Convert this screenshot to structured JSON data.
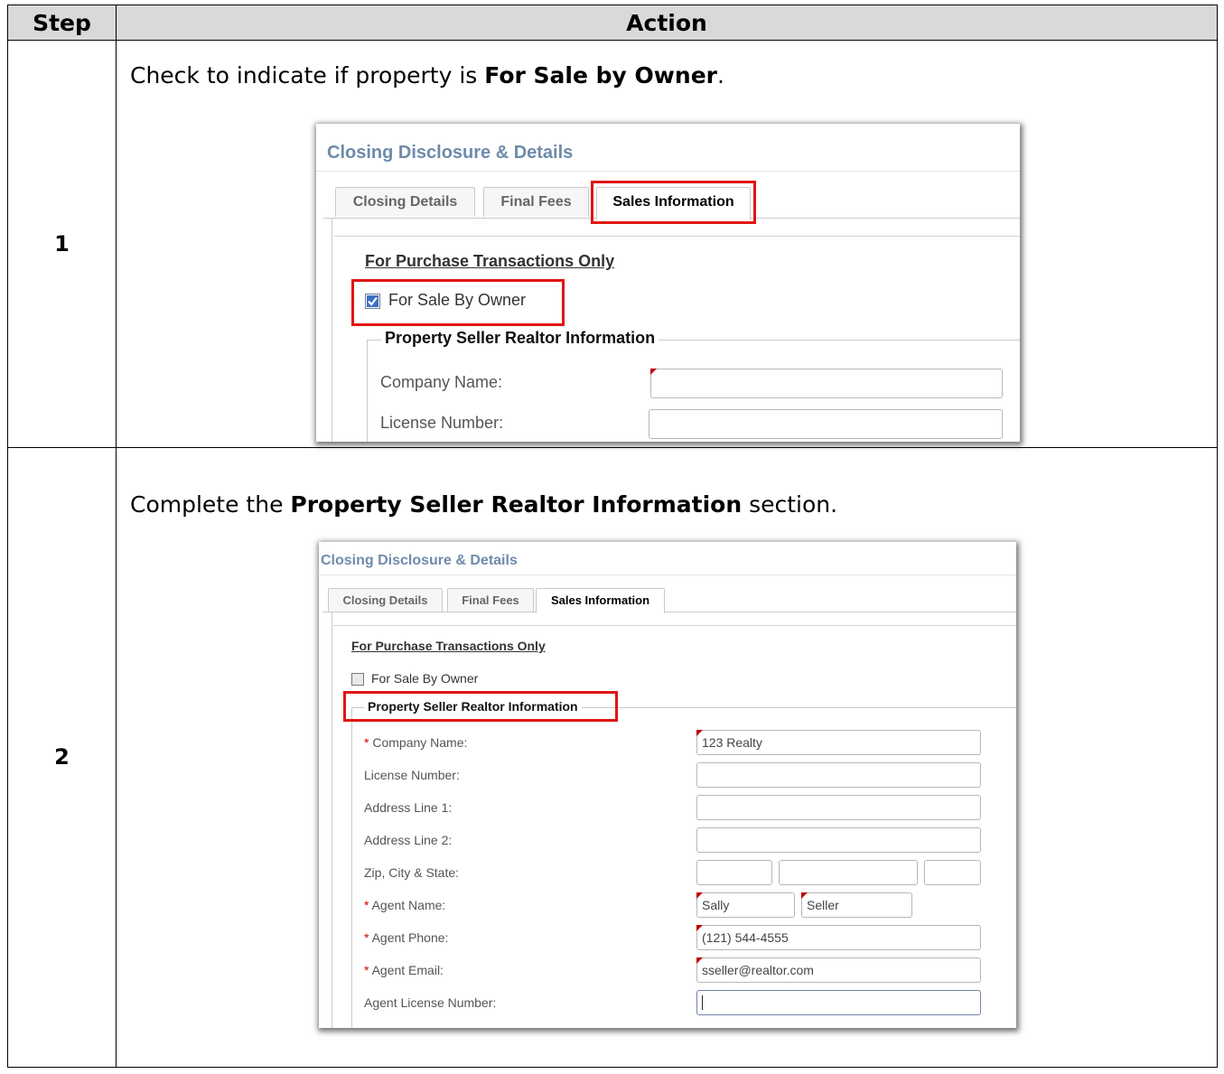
{
  "table": {
    "header_step": "Step",
    "header_action": "Action"
  },
  "step1": {
    "number": "1",
    "instruction_pre": "Check to indicate if property is ",
    "instruction_bold": "For Sale by Owner",
    "instruction_post": ".",
    "screen": {
      "title": "Closing Disclosure & Details",
      "tabs": [
        "Closing Details",
        "Final Fees",
        "Sales Information"
      ],
      "active_tab": "Sales Information",
      "section_heading": "For Purchase Transactions Only",
      "checkbox_label": "For Sale By Owner",
      "checkbox_checked": true,
      "fieldset_legend": "Property Seller Realtor Information",
      "fields": [
        {
          "label": "Company Name:",
          "value": ""
        },
        {
          "label": "License Number:",
          "value": ""
        }
      ]
    }
  },
  "step2": {
    "number": "2",
    "instruction_pre": "Complete the ",
    "instruction_bold": "Property Seller Realtor Information",
    "instruction_post": " section.",
    "screen": {
      "title": "Closing Disclosure & Details",
      "tabs": [
        "Closing Details",
        "Final Fees",
        "Sales Information"
      ],
      "active_tab": "Sales Information",
      "section_heading": "For Purchase Transactions Only",
      "checkbox_label": "For Sale By Owner",
      "checkbox_checked": false,
      "fieldset_legend": "Property Seller Realtor Information",
      "required_marker": "*",
      "fields": {
        "company_name": {
          "label": "Company Name:",
          "value": "123 Realty"
        },
        "license_number": {
          "label": "License Number:",
          "value": ""
        },
        "address_line_1": {
          "label": "Address Line 1:",
          "value": ""
        },
        "address_line_2": {
          "label": "Address Line 2:",
          "value": ""
        },
        "zip_city_state": {
          "label": "Zip, City & State:",
          "zip": "",
          "city": "",
          "state": ""
        },
        "agent_name": {
          "label": "Agent Name:",
          "first": "Sally",
          "last": "Seller"
        },
        "agent_phone": {
          "label": "Agent Phone:",
          "value": "(121) 544-4555"
        },
        "agent_email": {
          "label": "Agent Email:",
          "value": "sseller@realtor.com"
        },
        "agent_license_number": {
          "label": "Agent License Number:",
          "value": ""
        }
      }
    }
  },
  "colors": {
    "highlight": "#e01515",
    "title_blue": "#6f8bab",
    "required_red": "#d40000",
    "header_gray": "#d9d9d9"
  }
}
